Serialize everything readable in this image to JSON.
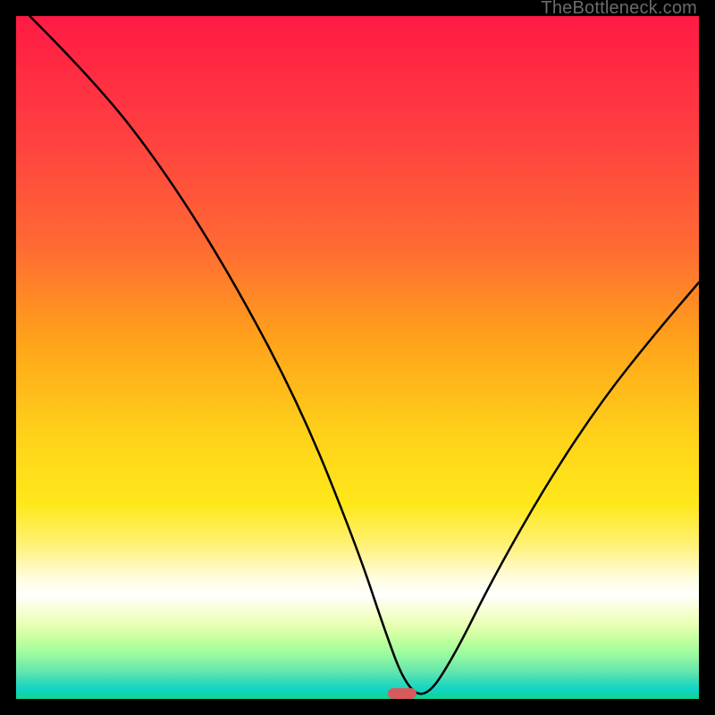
{
  "attribution": "TheBottleneck.com",
  "marker": {
    "x_frac": 0.565,
    "y_frac": 0.992
  },
  "chart_data": {
    "type": "line",
    "title": "",
    "xlabel": "",
    "ylabel": "",
    "xlim": [
      0,
      100
    ],
    "ylim": [
      0,
      100
    ],
    "series": [
      {
        "name": "curve",
        "x": [
          2,
          12,
          22,
          32,
          42,
          50,
          54,
          57,
          60,
          64,
          70,
          78,
          86,
          94,
          100
        ],
        "y": [
          100,
          90,
          77,
          61,
          42,
          22,
          10,
          2,
          0,
          6,
          18,
          32,
          44,
          54,
          61
        ]
      }
    ],
    "annotations": [
      {
        "kind": "marker",
        "shape": "pill",
        "color": "#d85a5c",
        "x": 56.5,
        "y": 0
      }
    ],
    "background_gradient": {
      "direction": "vertical",
      "stops": [
        {
          "pos": 0.0,
          "color": "#ff1a44"
        },
        {
          "pos": 0.18,
          "color": "#ff4040"
        },
        {
          "pos": 0.34,
          "color": "#ff6a33"
        },
        {
          "pos": 0.48,
          "color": "#ffa31a"
        },
        {
          "pos": 0.62,
          "color": "#ffd21a"
        },
        {
          "pos": 0.72,
          "color": "#ffe81a"
        },
        {
          "pos": 0.78,
          "color": "#fff176"
        },
        {
          "pos": 0.83,
          "color": "#fffde0"
        },
        {
          "pos": 0.855,
          "color": "#ffffff"
        },
        {
          "pos": 0.875,
          "color": "#f8ffd6"
        },
        {
          "pos": 0.895,
          "color": "#ecffb8"
        },
        {
          "pos": 0.91,
          "color": "#d6ffa8"
        },
        {
          "pos": 0.925,
          "color": "#baff9e"
        },
        {
          "pos": 0.94,
          "color": "#9efc9e"
        },
        {
          "pos": 0.955,
          "color": "#7ff0a6"
        },
        {
          "pos": 0.97,
          "color": "#5ee4b0"
        },
        {
          "pos": 0.98,
          "color": "#3bdcb8"
        },
        {
          "pos": 0.99,
          "color": "#1cd6bf"
        },
        {
          "pos": 1.0,
          "color": "#0ad4c4"
        }
      ]
    }
  }
}
